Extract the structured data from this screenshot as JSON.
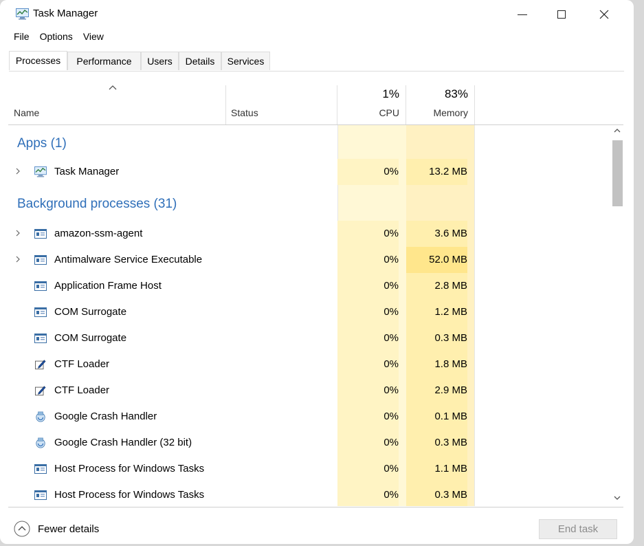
{
  "window": {
    "title": "Task Manager",
    "icon": "task-manager-icon"
  },
  "controls": {
    "minimize": "minimize-icon",
    "maximize": "maximize-icon",
    "close": "close-icon"
  },
  "menu": [
    "File",
    "Options",
    "View"
  ],
  "tabs": [
    {
      "label": "Processes",
      "active": true
    },
    {
      "label": "Performance",
      "active": false
    },
    {
      "label": "Users",
      "active": false
    },
    {
      "label": "Details",
      "active": false
    },
    {
      "label": "Services",
      "active": false
    }
  ],
  "columns": {
    "name": "Name",
    "status": "Status",
    "cpu_pct": "1%",
    "cpu_label": "CPU",
    "mem_pct": "83%",
    "mem_label": "Memory"
  },
  "groups": {
    "apps": "Apps (1)",
    "background": "Background processes (31)"
  },
  "processes": [
    {
      "name": "Task Manager",
      "cpu": "0%",
      "mem": "13.2 MB",
      "icon": "task-manager-icon",
      "expandable": true
    },
    {
      "name": "amazon-ssm-agent",
      "cpu": "0%",
      "mem": "3.6 MB",
      "icon": "window-app-icon",
      "expandable": true
    },
    {
      "name": "Antimalware Service Executable",
      "cpu": "0%",
      "mem": "52.0 MB",
      "icon": "window-app-icon",
      "expandable": true
    },
    {
      "name": "Application Frame Host",
      "cpu": "0%",
      "mem": "2.8 MB",
      "icon": "window-app-icon",
      "expandable": false
    },
    {
      "name": "COM Surrogate",
      "cpu": "0%",
      "mem": "1.2 MB",
      "icon": "window-app-icon",
      "expandable": false
    },
    {
      "name": "COM Surrogate",
      "cpu": "0%",
      "mem": "0.3 MB",
      "icon": "window-app-icon",
      "expandable": false
    },
    {
      "name": "CTF Loader",
      "cpu": "0%",
      "mem": "1.8 MB",
      "icon": "pen-icon",
      "expandable": false
    },
    {
      "name": "CTF Loader",
      "cpu": "0%",
      "mem": "2.9 MB",
      "icon": "pen-icon",
      "expandable": false
    },
    {
      "name": "Google Crash Handler",
      "cpu": "0%",
      "mem": "0.1 MB",
      "icon": "crash-handler-icon",
      "expandable": false
    },
    {
      "name": "Google Crash Handler (32 bit)",
      "cpu": "0%",
      "mem": "0.3 MB",
      "icon": "crash-handler-icon",
      "expandable": false
    },
    {
      "name": "Host Process for Windows Tasks",
      "cpu": "0%",
      "mem": "1.1 MB",
      "icon": "window-app-icon",
      "expandable": false
    },
    {
      "name": "Host Process for Windows Tasks",
      "cpu": "0%",
      "mem": "0.3 MB",
      "icon": "window-app-icon",
      "expandable": false
    }
  ],
  "footer": {
    "fewer_details": "Fewer details",
    "end_task": "End task"
  }
}
